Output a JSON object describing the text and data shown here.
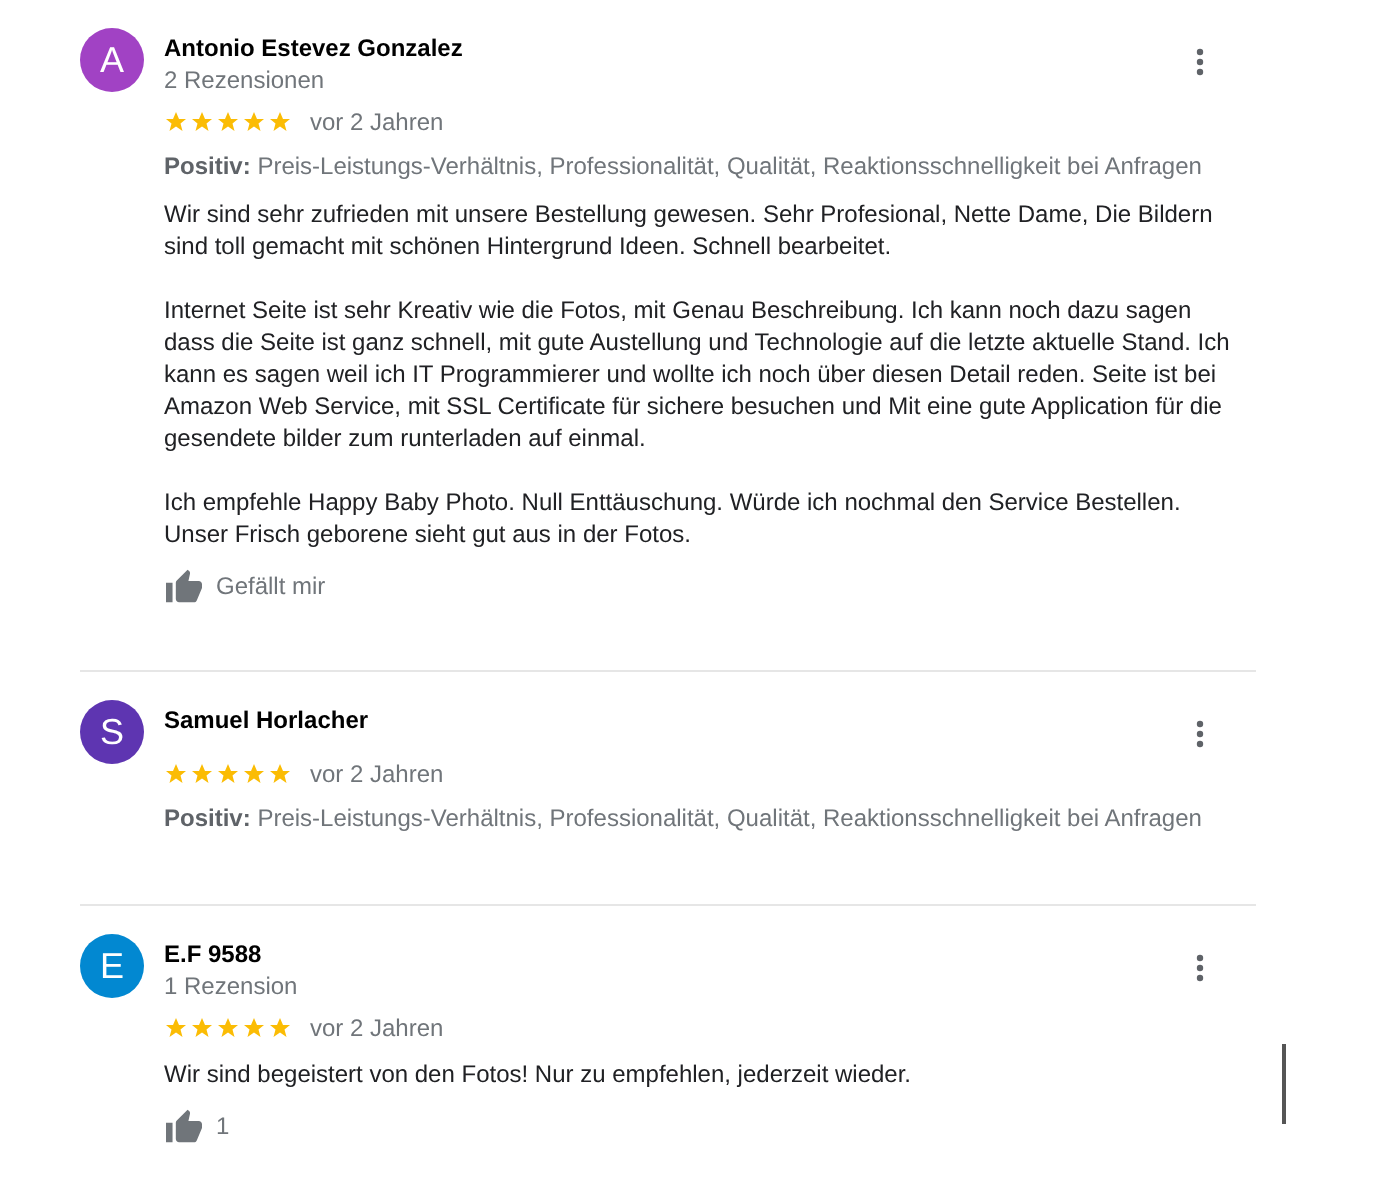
{
  "reviews": [
    {
      "initial": "A",
      "color": "#a142c4",
      "name": "Antonio Estevez Gonzalez",
      "count": "2 Rezensionen",
      "stars": 5,
      "time": "vor 2 Jahren",
      "positive_label": "Positiv:",
      "positive": "Preis-Leistungs-Verhältnis, Professionalität, Qualität, Reaktionsschnelligkeit bei Anfragen",
      "paragraphs": [
        "Wir sind sehr zufrieden mit unsere Bestellung gewesen. Sehr Profesional, Nette Dame, Die Bildern sind toll gemacht mit schönen Hintergrund Ideen. Schnell bearbeitet.",
        "Internet Seite ist sehr Kreativ wie die Fotos, mit Genau Beschreibung. Ich kann noch dazu sagen dass die Seite ist ganz schnell, mit gute Austellung und Technologie auf die letzte aktuelle Stand. Ich kann es sagen weil ich IT Programmierer und wollte ich noch über diesen Detail reden. Seite ist bei Amazon Web Service, mit SSL Certificate für sichere besuchen und Mit eine gute Application für die gesendete bilder zum runterladen auf einmal.",
        "Ich empfehle Happy Baby Photo. Null Enttäuschung. Würde ich nochmal den Service Bestellen. Unser Frisch geborene sieht gut aus in der Fotos."
      ],
      "like": "Gefällt mir"
    },
    {
      "initial": "S",
      "color": "#5e35b1",
      "name": "Samuel Horlacher",
      "stars": 5,
      "time": "vor 2 Jahren",
      "positive_label": "Positiv:",
      "positive": "Preis-Leistungs-Verhältnis, Professionalität, Qualität, Reaktionsschnelligkeit bei Anfragen"
    },
    {
      "initial": "E",
      "color": "#0288d1",
      "name": "E.F 9588",
      "count": "1 Rezension",
      "stars": 5,
      "time": "vor 2 Jahren",
      "paragraphs": [
        "Wir sind begeistert von den Fotos! Nur zu empfehlen, jederzeit wieder."
      ],
      "like": "1"
    }
  ]
}
